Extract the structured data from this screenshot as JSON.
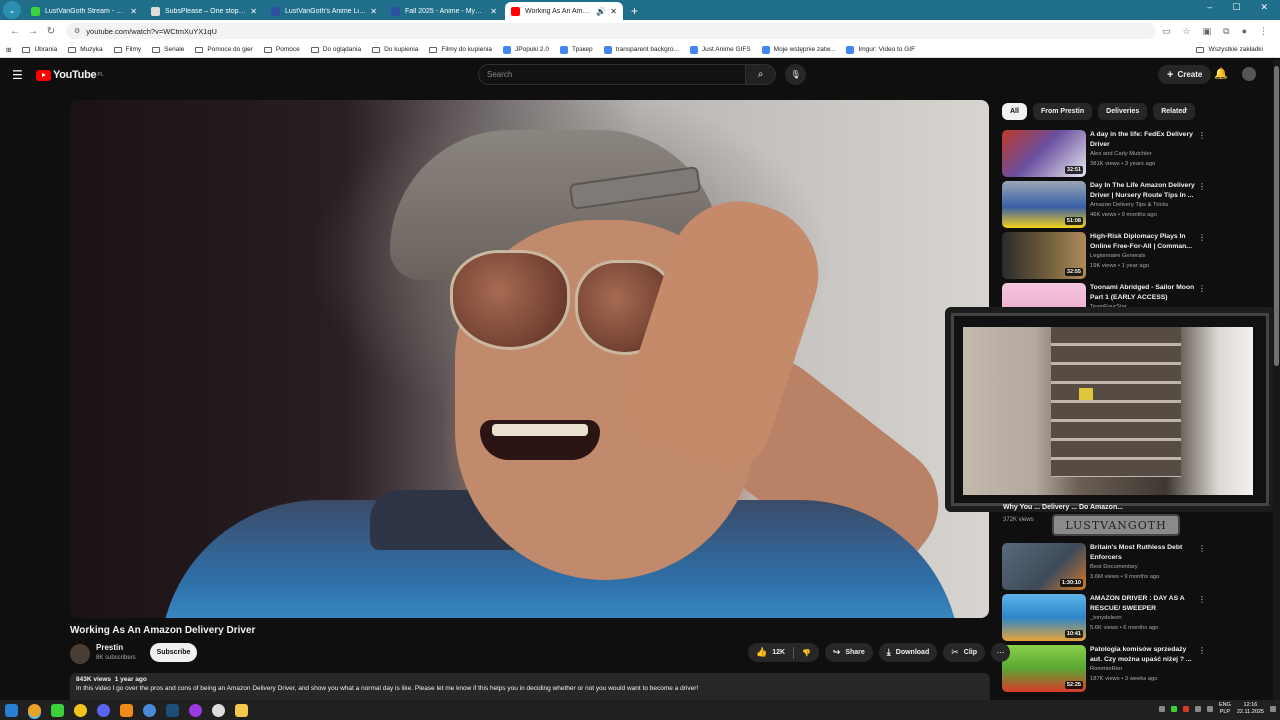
{
  "browser": {
    "tabs": [
      {
        "title": "LustVanGoth Stream - Watch L",
        "fav": "#3ad13a",
        "active": false
      },
      {
        "title": "SubsPlease – One stop shop fo",
        "fav": "#dddddd",
        "active": false
      },
      {
        "title": "LustVanGoth's Anime List - My",
        "fav": "#2e51a2",
        "active": false
      },
      {
        "title": "Fall 2025 - Anime - MyAnimeLi",
        "fav": "#2e51a2",
        "active": false
      },
      {
        "title": "Working As An Amazon Deli",
        "fav": "#ff0000",
        "active": true
      }
    ],
    "url": "youtube.com/watch?v=WCtmXuYX1qU",
    "bookmarks": [
      "Ubrania",
      "Muzyka",
      "Filmy",
      "Seriale",
      "Pomoce do gier",
      "Pomoce",
      "Do oglądania",
      "Do kupienia",
      "Filmy do kupienia",
      "JPopuki 2.0",
      "Трэкер",
      "transparent backgro...",
      "Just Anime GIFS",
      "Moje wstępnie zatw...",
      "Imgur: Video to GIF"
    ],
    "bookmarks_all": "Wszystkie zakładki"
  },
  "youtube": {
    "logo_text": "YouTube",
    "region": "PL",
    "search_placeholder": "Search",
    "create_label": "Create"
  },
  "video": {
    "title": "Working As An Amazon Delivery Driver",
    "channel": "Prestin",
    "subscribers": "8K subscribers",
    "subscribe_label": "Subscribe",
    "likes": "12K",
    "share_label": "Share",
    "download_label": "Download",
    "clip_label": "Clip",
    "views": "843K views",
    "age": "1 year ago",
    "description": "In this video I go over the pros and cons of being an Amazon Delivery Driver, and show you what a normal day is like. Please let me know if this helps you in deciding whether or not you would want to become a driver!"
  },
  "chips": [
    "All",
    "From Prestin",
    "Deliveries",
    "Related"
  ],
  "recommendations": [
    {
      "title": "A day in the life: FedEx Delivery Driver",
      "channel": "Alex and Carly Mutchler",
      "meta": "381K views • 3 years ago",
      "duration": "32:51",
      "color": "#6a4fa0"
    },
    {
      "title": "Day In The Life Amazon Delivery Driver | Nursery Route Tips In ...",
      "channel": "Amazon Delivery Tips & Tricks",
      "meta": "46K views • 9 months ago",
      "duration": "51:08",
      "color": "#3a5fa8"
    },
    {
      "title": "High-Risk Diplomacy Plays In Online Free-For-All | Comman...",
      "channel": "Legionnaire Generals",
      "meta": "19K views • 1 year ago",
      "duration": "32:55",
      "color": "#6b5a3a"
    },
    {
      "title": "Toonami Abridged - Sailor Moon Part 1 (EARLY ACCESS)",
      "channel": "TeamFourStar",
      "meta": "",
      "duration": "",
      "color": "#e8a0c8"
    },
    {
      "title": "Britain's Most Ruthless Debt Enforcers",
      "channel": "Best Documentary",
      "meta": "3.6M views • 9 months ago",
      "duration": "1:30:10",
      "color": "#3d4a5a"
    },
    {
      "title": "AMAZON DRIVER : DAY AS A RESCUE/ SWEEPER",
      "channel": "_tonydeleon",
      "meta": "5.6K views • 6 months ago",
      "duration": "10:41",
      "color": "#2c86c8"
    },
    {
      "title": "Patologia komisów sprzedaży aut. Czy można upaść niżej ? ...",
      "channel": "RommieRen",
      "meta": "187K views • 3 weeks ago",
      "duration": "52:25",
      "color": "#5aa832"
    }
  ],
  "partial_row": {
    "title": "Why You ...    Delivery ...    Do Amazon...",
    "views": "372K views"
  },
  "overlay": {
    "brand": "LUSTVANGOTH"
  },
  "taskbar": {
    "lang": "ENG\nPLP",
    "time": "12:16",
    "date": "22.11.2025"
  }
}
